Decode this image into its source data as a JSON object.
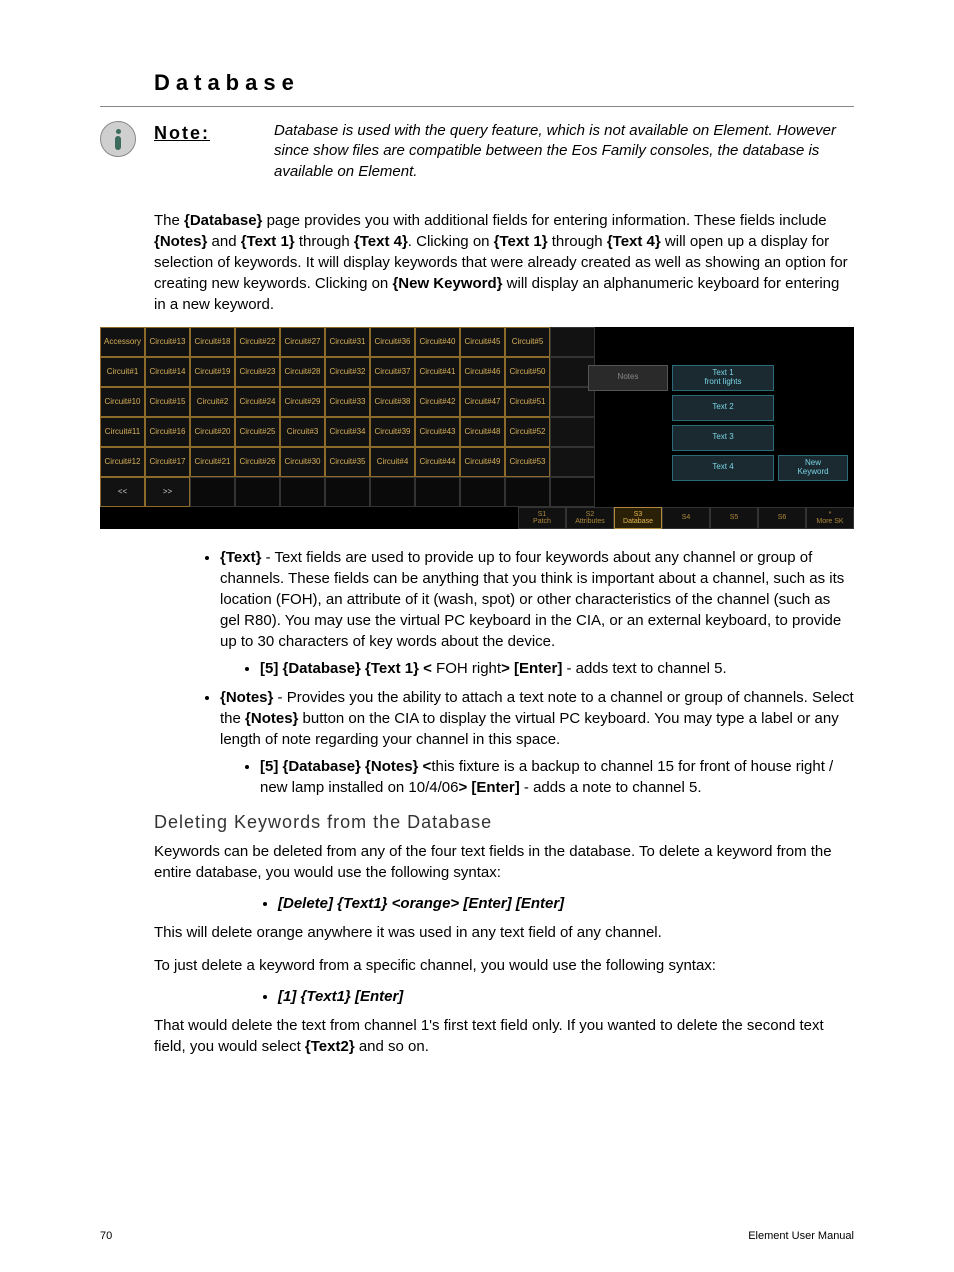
{
  "title": "Database",
  "note_label": "Note:",
  "note_body": "Database is used with the query feature, which is not available on Element. However since show files are compatible between the Eos Family consoles, the database is available on Element.",
  "intro": "The <b>{Database}</b> page provides you with additional fields for entering information. These fields include <b>{Notes}</b> and <b>{Text 1}</b> through <b>{Text 4}</b>. Clicking on <b>{Text 1}</b> through <b>{Text 4}</b> will open up a display for selection of keywords. It will display keywords that were already created as well as showing an option for creating new keywords. Clicking on <b>{New Keyword}</b> will display an alphanumeric keyboard for entering in a new keyword.",
  "grid": {
    "cols": [
      [
        "Accessory",
        "Circuit#1",
        "Circuit#10",
        "Circuit#11",
        "Circuit#12",
        "<<"
      ],
      [
        "Circuit#13",
        "Circuit#14",
        "Circuit#15",
        "Circuit#16",
        "Circuit#17",
        ">>"
      ],
      [
        "Circuit#18",
        "Circuit#19",
        "Circuit#2",
        "Circuit#20",
        "Circuit#21",
        ""
      ],
      [
        "Circuit#22",
        "Circuit#23",
        "Circuit#24",
        "Circuit#25",
        "Circuit#26",
        ""
      ],
      [
        "Circuit#27",
        "Circuit#28",
        "Circuit#29",
        "Circuit#3",
        "Circuit#30",
        ""
      ],
      [
        "Circuit#31",
        "Circuit#32",
        "Circuit#33",
        "Circuit#34",
        "Circuit#35",
        ""
      ],
      [
        "Circuit#36",
        "Circuit#37",
        "Circuit#38",
        "Circuit#39",
        "Circuit#4",
        ""
      ],
      [
        "Circuit#40",
        "Circuit#41",
        "Circuit#42",
        "Circuit#43",
        "Circuit#44",
        ""
      ],
      [
        "Circuit#45",
        "Circuit#46",
        "Circuit#47",
        "Circuit#48",
        "Circuit#49",
        ""
      ],
      [
        "Circuit#5",
        "Circuit#50",
        "Circuit#51",
        "Circuit#52",
        "Circuit#53",
        ""
      ]
    ]
  },
  "right_panel": {
    "notes": "Notes",
    "text1_a": "Text 1",
    "text1_b": "front lights",
    "text2": "Text 2",
    "text3": "Text 3",
    "text4": "Text 4",
    "new_kw_a": "New",
    "new_kw_b": "Keyword"
  },
  "tabs": [
    "S1\nPatch",
    "S2\nAttributes",
    "S3\nDatabase",
    "S4",
    "S5",
    "S6",
    "*\nMore SK"
  ],
  "bullet_text_lead": "{Text}",
  "bullet_text": " - Text fields are used to provide up to four keywords about any channel or group of channels. These fields can be anything that you think is important about a channel, such as its location (FOH), an attribute of it (wash, spot) or other characteristics of the channel (such as gel R80). You may use the virtual PC keyboard in the CIA, or an external keyboard, to provide up to 30 characters of key words about the device.",
  "bullet_text_sub": "<b>[5] {Database} {Text 1} &lt;</b> FOH right<b>&gt; [Enter]</b> - adds text to channel 5.",
  "bullet_notes_lead": "{Notes}",
  "bullet_notes": " - Provides you the ability to attach a text note to a channel or group of channels. Select the <b>{Notes}</b> button on the CIA to display the virtual PC keyboard. You may type a label or any length of note regarding your channel in this space.",
  "bullet_notes_sub": "<b>[5] {Database} {Notes} &lt;</b>this fixture is a backup to channel 15 for front of house right / new lamp installed on 10/4/06<b>&gt; [Enter]</b> - adds a note to channel 5.",
  "subheading": "Deleting Keywords from the Database",
  "del_p1": "Keywords can be deleted from any of the four text fields in the database. To delete a keyword from the entire database, you would use the following syntax:",
  "syntax1": "[Delete] {Text1} <orange> [Enter] [Enter]",
  "del_p2": "This will delete orange anywhere it was used in any text field of any channel.",
  "del_p3": "To just delete a keyword from a specific channel, you would use the following syntax:",
  "syntax2": "[1] {Text1} [Enter]",
  "del_p4": "That would delete the text from channel 1's first text field only. If you wanted to delete the second text field, you would select <b>{Text2}</b> and so on.",
  "page_num": "70",
  "footer_right": "Element User Manual"
}
